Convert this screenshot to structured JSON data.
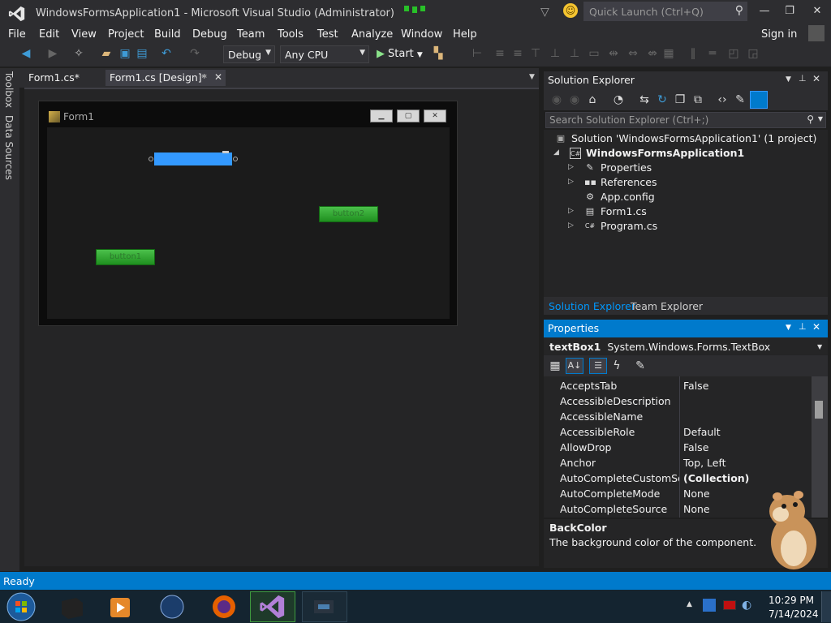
{
  "window": {
    "title": "WindowsFormsApplication1 - Microsoft Visual Studio (Administrator)",
    "quick_launch_placeholder": "Quick Launch (Ctrl+Q)",
    "minimize": "—",
    "restore": "❐",
    "close": "✕"
  },
  "menu": [
    "File",
    "Edit",
    "View",
    "Project",
    "Build",
    "Debug",
    "Team",
    "Tools",
    "Test",
    "Analyze",
    "Window",
    "Help"
  ],
  "signin": "Sign in",
  "toolbar": {
    "config": "Debug",
    "platform": "Any CPU",
    "start": "Start"
  },
  "left_tabs": {
    "toolbox": "Toolbox",
    "data_sources": "Data Sources"
  },
  "doc_tabs": {
    "code": "Form1.cs*",
    "design": "Form1.cs [Design]*"
  },
  "form": {
    "title": "Form1",
    "button1": "button1",
    "button2": "button2"
  },
  "solution_explorer": {
    "title": "Solution Explorer",
    "search_placeholder": "Search Solution Explorer (Ctrl+;)",
    "tree": [
      {
        "label": "Solution 'WindowsFormsApplication1' (1 project)",
        "icon": "solution-icon"
      },
      {
        "label": "WindowsFormsApplication1",
        "icon": "csharp-project-icon"
      },
      {
        "label": "Properties",
        "icon": "wrench-icon"
      },
      {
        "label": "References",
        "icon": "references-icon"
      },
      {
        "label": "App.config",
        "icon": "config-file-icon"
      },
      {
        "label": "Form1.cs",
        "icon": "form-icon"
      },
      {
        "label": "Program.cs",
        "icon": "csharp-file-icon"
      }
    ],
    "tab_solution": "Solution Explorer",
    "tab_team": "Team Explorer"
  },
  "properties": {
    "title": "Properties",
    "object": "textBox1",
    "object_type": "System.Windows.Forms.TextBox",
    "rows": [
      {
        "name": "AcceptsTab",
        "value": "False"
      },
      {
        "name": "AccessibleDescription",
        "value": ""
      },
      {
        "name": "AccessibleName",
        "value": ""
      },
      {
        "name": "AccessibleRole",
        "value": "Default"
      },
      {
        "name": "AllowDrop",
        "value": "False"
      },
      {
        "name": "Anchor",
        "value": "Top, Left"
      },
      {
        "name": "AutoCompleteCustomSource",
        "value": "(Collection)"
      },
      {
        "name": "AutoCompleteMode",
        "value": "None"
      },
      {
        "name": "AutoCompleteSource",
        "value": "None"
      }
    ],
    "desc_name": "BackColor",
    "desc_text": "The background color of the component."
  },
  "status": "Ready",
  "clock": {
    "time": "10:29 PM",
    "date": "7/14/2024"
  },
  "colors": {
    "accent": "#007acc",
    "textbox_selected": "#3399ff",
    "button_green": "#33a833"
  }
}
